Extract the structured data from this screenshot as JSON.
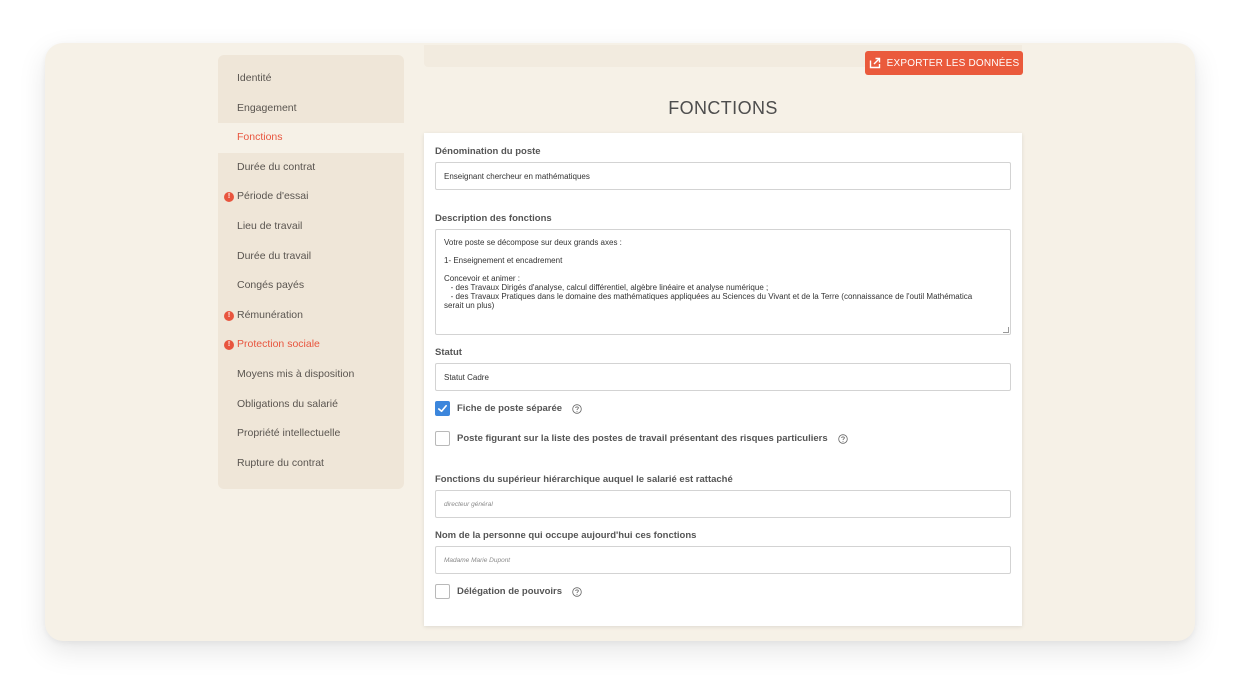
{
  "sidebar": {
    "items": [
      {
        "label": "Identité",
        "state": "normal"
      },
      {
        "label": "Engagement",
        "state": "normal"
      },
      {
        "label": "Fonctions",
        "state": "active"
      },
      {
        "label": "Durée du contrat",
        "state": "normal"
      },
      {
        "label": "Période d'essai",
        "state": "warning"
      },
      {
        "label": "Lieu de travail",
        "state": "normal"
      },
      {
        "label": "Durée du travail",
        "state": "normal"
      },
      {
        "label": "Congés payés",
        "state": "normal"
      },
      {
        "label": "Rémunération",
        "state": "warning"
      },
      {
        "label": "Protection sociale",
        "state": "error"
      },
      {
        "label": "Moyens mis à disposition",
        "state": "normal"
      },
      {
        "label": "Obligations du salarié",
        "state": "normal"
      },
      {
        "label": "Propriété intellectuelle",
        "state": "normal"
      },
      {
        "label": "Rupture du contrat",
        "state": "normal"
      }
    ],
    "badge_text": "!"
  },
  "header": {
    "export_label": "EXPORTER LES DONNÉES",
    "export_icon": "export-icon",
    "page_title": "FONCTIONS"
  },
  "form": {
    "poste_label": "Dénomination du poste",
    "poste_value": "Enseignant chercheur en mathématiques",
    "description_label": "Description des fonctions",
    "description_lines": [
      "Votre poste se décompose sur deux grands axes :",
      "",
      "1- Enseignement et encadrement",
      "",
      "Concevoir et animer :",
      "   - des Travaux Dirigés d'analyse, calcul différentiel, algèbre linéaire et analyse numérique ;",
      "   - des Travaux Pratiques dans le domaine des mathématiques appliquées au Sciences du Vivant et de la Terre (connaissance de l'outil Mathématica",
      "serait un plus)"
    ],
    "statut_label": "Statut",
    "statut_value": "Statut Cadre",
    "fiche_label": "Fiche de poste séparée",
    "fiche_checked": true,
    "risques_label": "Poste figurant sur la liste des postes de travail présentant des risques particuliers",
    "risques_checked": false,
    "superieur_label": "Fonctions du supérieur hiérarchique auquel le salarié est rattaché",
    "superieur_placeholder": "directeur général",
    "nom_label": "Nom de la personne qui occupe aujourd'hui ces fonctions",
    "nom_placeholder": "Madame Marie Dupont",
    "delegation_label": "Délégation de pouvoirs",
    "delegation_checked": false
  },
  "colors": {
    "accent": "#ea5a3c",
    "checkbox_blue": "#3c86dc",
    "shell_bg": "#f6f1e7",
    "sidebar_bg": "#efe6d8"
  }
}
